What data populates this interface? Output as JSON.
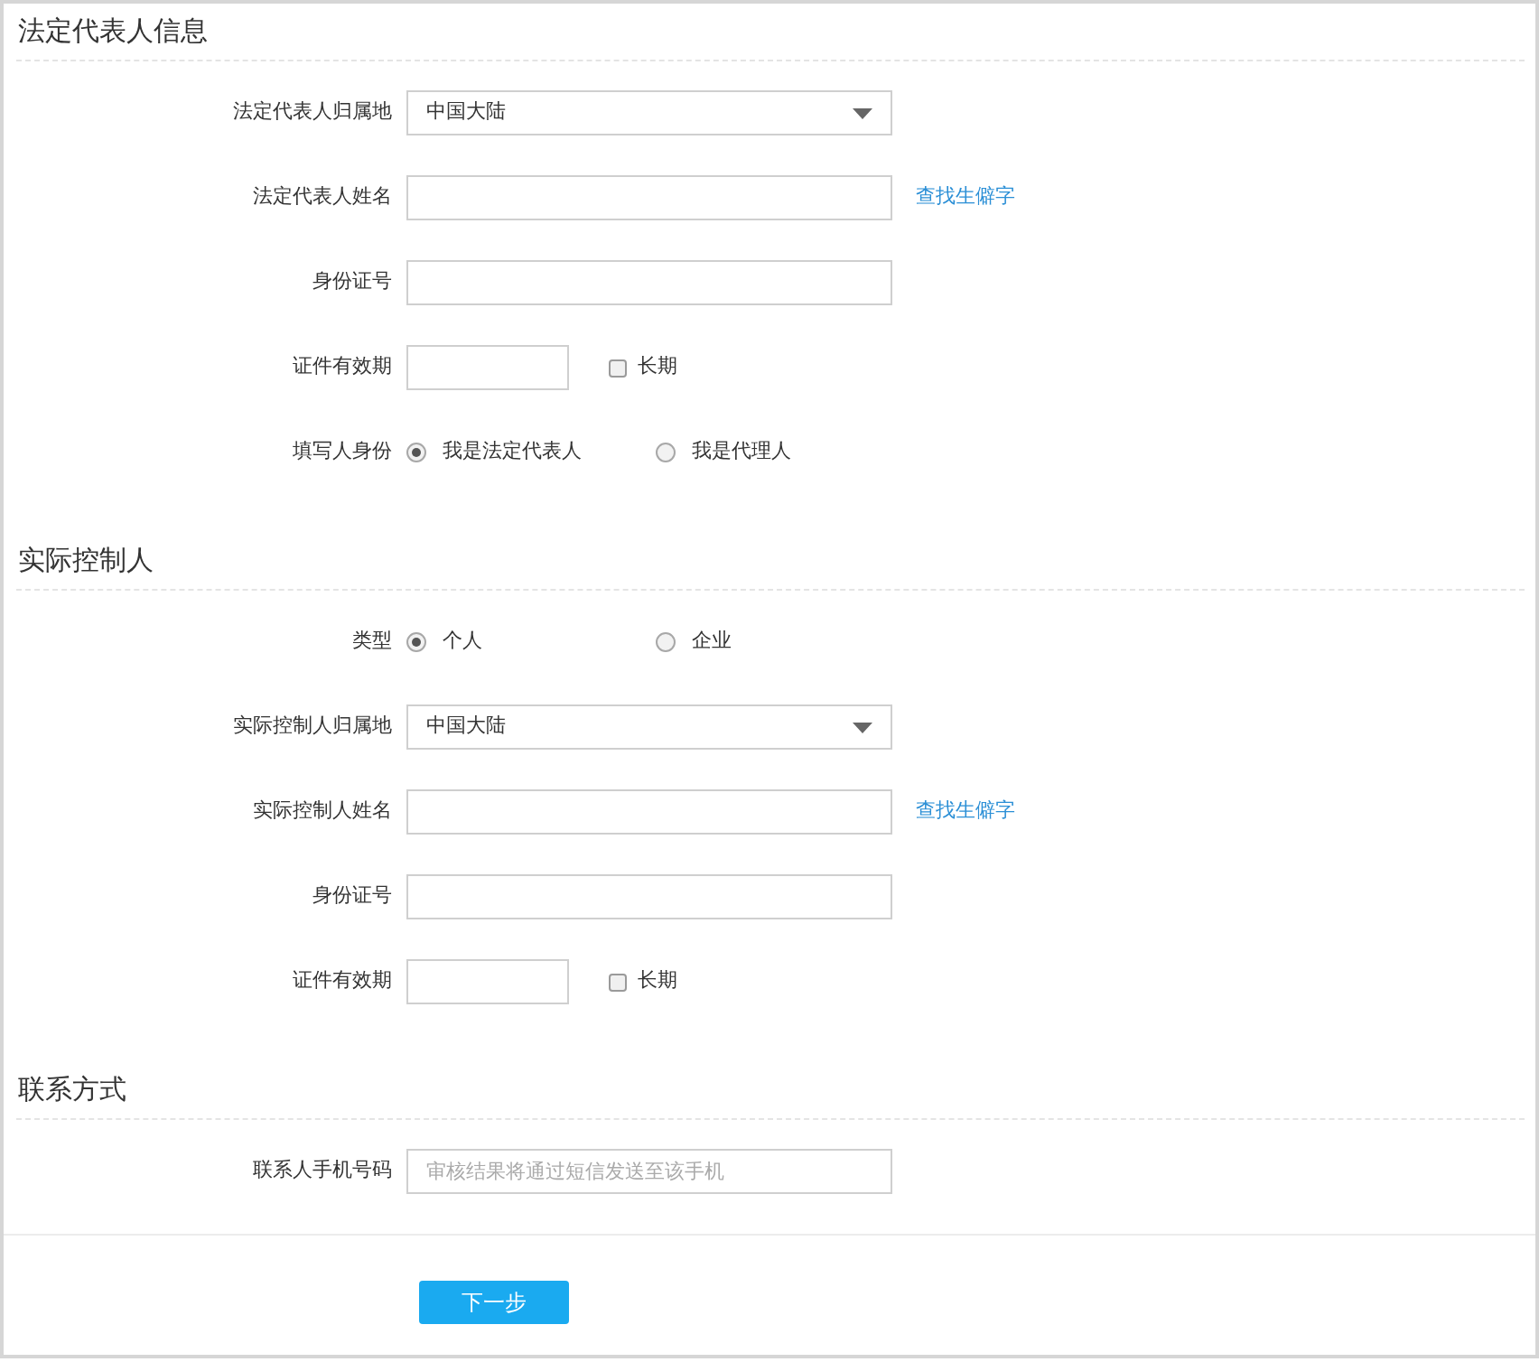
{
  "sections": [
    {
      "title": "法定代表人信息",
      "fields": [
        {
          "kind": "select",
          "label": "法定代表人归属地",
          "value": "中国大陆"
        },
        {
          "kind": "text",
          "label": "法定代表人姓名",
          "link": "查找生僻字"
        },
        {
          "kind": "text",
          "label": "身份证号"
        },
        {
          "kind": "date",
          "label": "证件有效期",
          "checkbox": {
            "label": "长期",
            "checked": false
          }
        },
        {
          "kind": "radio",
          "label": "填写人身份",
          "options": [
            {
              "label": "我是法定代表人",
              "selected": true
            },
            {
              "label": "我是代理人",
              "selected": false
            }
          ]
        }
      ]
    },
    {
      "title": "实际控制人",
      "fields": [
        {
          "kind": "radio",
          "label": "类型",
          "options": [
            {
              "label": "个人",
              "selected": true
            },
            {
              "label": "企业",
              "selected": false
            }
          ]
        },
        {
          "kind": "select",
          "label": "实际控制人归属地",
          "value": "中国大陆"
        },
        {
          "kind": "text",
          "label": "实际控制人姓名",
          "link": "查找生僻字"
        },
        {
          "kind": "text",
          "label": "身份证号"
        },
        {
          "kind": "date",
          "label": "证件有效期",
          "checkbox": {
            "label": "长期",
            "checked": false
          }
        }
      ]
    },
    {
      "title": "联系方式",
      "fields": [
        {
          "kind": "text",
          "label": "联系人手机号码",
          "placeholder": "审核结果将通过短信发送至该手机"
        }
      ]
    }
  ],
  "submit": "下一步"
}
